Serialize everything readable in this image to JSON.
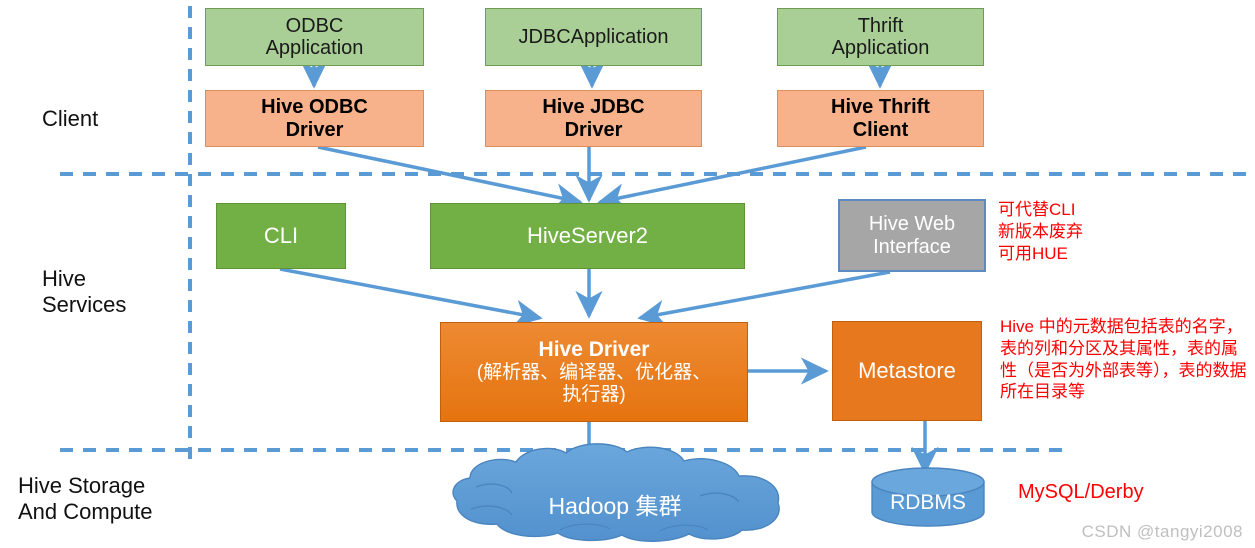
{
  "diagram": {
    "title": "Hive Architecture",
    "colors": {
      "app_green": "#A9CF96",
      "driver_orange": "#F7B28C",
      "service_green": "#72AF44",
      "web_gray": "#A6A6A6",
      "hive_driver_orange": "#E8781E",
      "metastore_orange": "#E8781E",
      "cloud_blue": "#5B9BD5",
      "arrow_blue": "#5B9BD5",
      "note_red": "#FF0000",
      "watermark_gray": "#BFBFBF"
    }
  },
  "zones": [
    {
      "id": "client",
      "label": "Client"
    },
    {
      "id": "hive-services",
      "label": "Hive\nServices"
    },
    {
      "id": "hive-storage",
      "label": "Hive Storage\nAnd Compute"
    }
  ],
  "zone_labels": {
    "client": "Client",
    "services_line1": "Hive",
    "services_line2": "Services",
    "storage_line1": "Hive Storage",
    "storage_line2": "And Compute"
  },
  "client_layer": {
    "applications": [
      {
        "id": "odbc-application",
        "line1": "ODBC",
        "line2": "Application"
      },
      {
        "id": "jdbc-application",
        "line1": "JDBCApplication",
        "line2": ""
      },
      {
        "id": "thrift-application",
        "line1": "Thrift",
        "line2": "Application"
      }
    ],
    "drivers": [
      {
        "id": "hive-odbc-driver",
        "line1": "Hive ODBC",
        "line2": "Driver"
      },
      {
        "id": "hive-jdbc-driver",
        "line1": "Hive JDBC",
        "line2": "Driver"
      },
      {
        "id": "hive-thrift-client",
        "line1": "Hive Thrift",
        "line2": "Client"
      }
    ]
  },
  "services_layer": {
    "cli": "CLI",
    "hiveserver2": "HiveServer2",
    "web_interface_line1": "Hive Web",
    "web_interface_line2": "Interface",
    "hive_driver": {
      "title": "Hive Driver",
      "subtitle_line1": "(解析器、编译器、优化器、",
      "subtitle_line2": "执行器)"
    },
    "metastore": "Metastore"
  },
  "storage_layer": {
    "hadoop_cluster": "Hadoop 集群",
    "rdbms": "RDBMS"
  },
  "notes": {
    "web_interface_note_line1": "可代替CLI",
    "web_interface_note_line2": "新版本废弃",
    "web_interface_note_line3": "可用HUE",
    "metastore_note": "Hive 中的元数据包括表的名字，表的列和分区及其属性，表的属性（是否为外部表等），表的数据所在目录等",
    "rdbms_note": "MySQL/Derby"
  },
  "watermark": "CSDN @tangyi2008"
}
